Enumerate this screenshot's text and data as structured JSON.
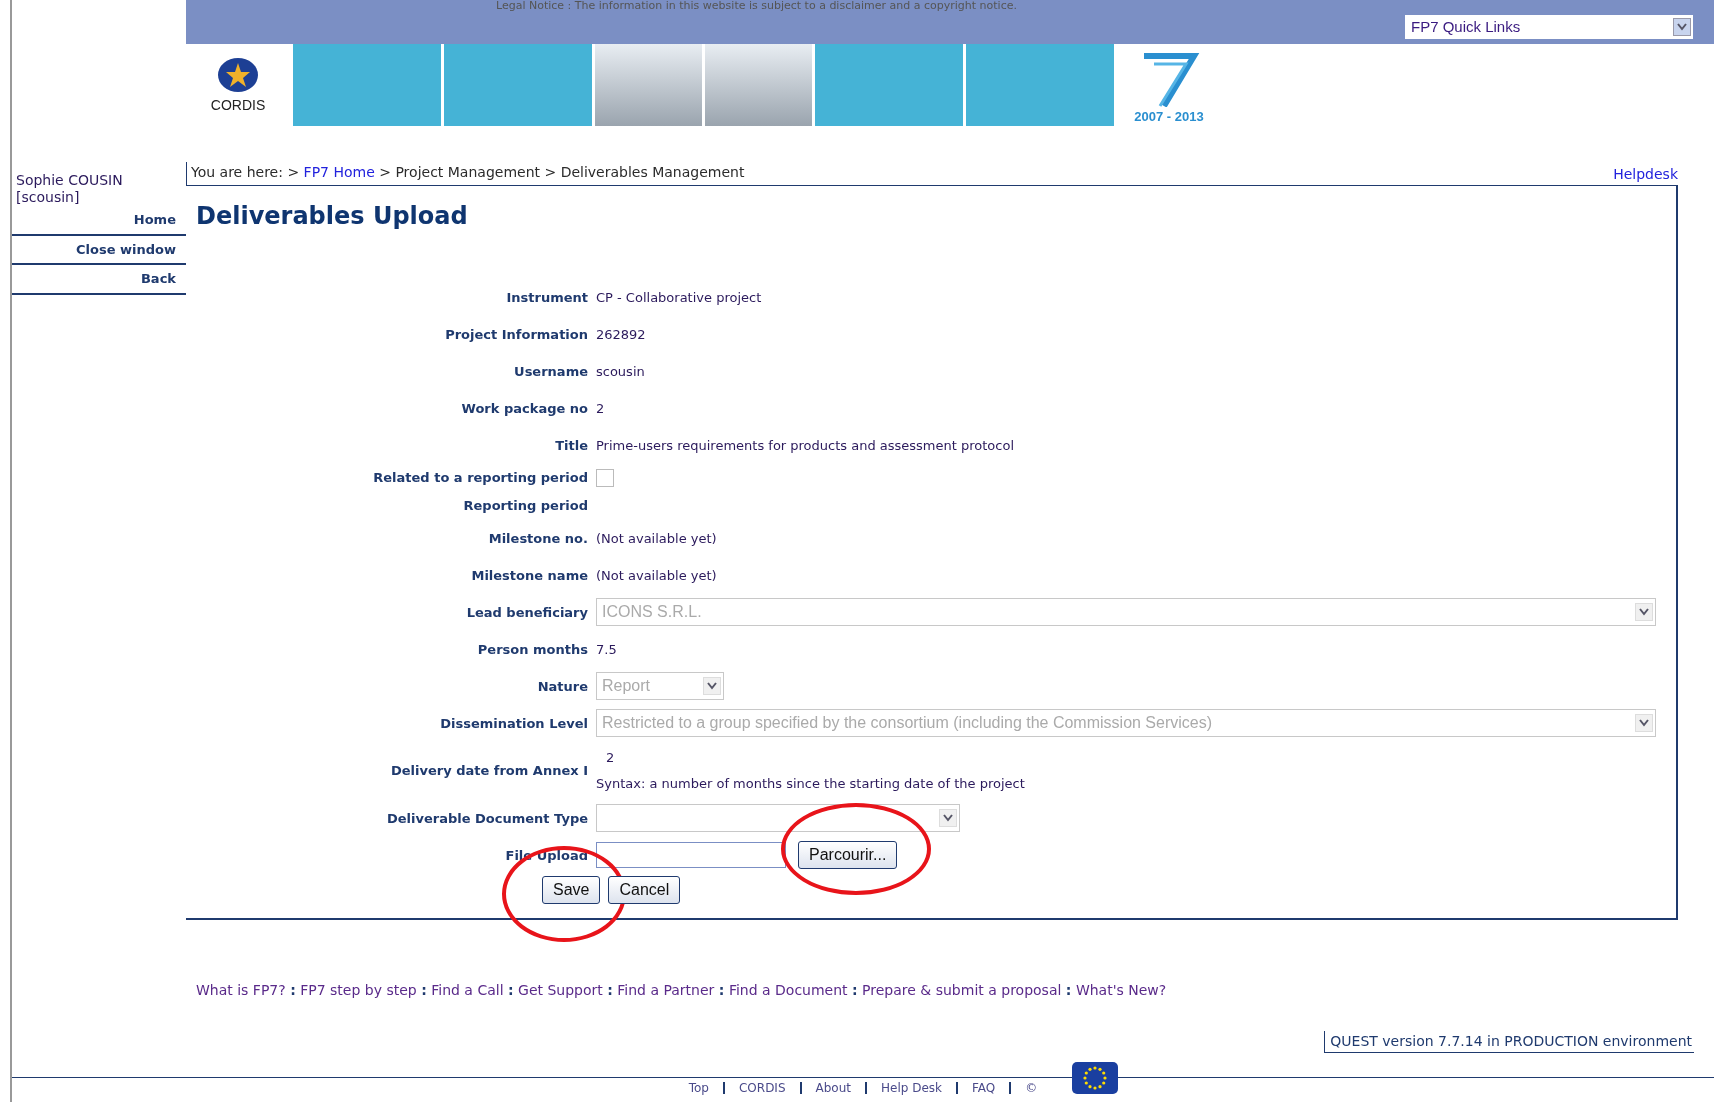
{
  "legal_notice": "Legal Notice : The information in this website is subject to a disclaimer and a copyright notice.",
  "quick_links": {
    "value": "FP7 Quick Links"
  },
  "logo": {
    "text": "CORDIS"
  },
  "fp7_logo": {
    "years": "2007 - 2013"
  },
  "banner_tiles": [
    {
      "kind": "plain"
    },
    {
      "kind": "plain"
    },
    {
      "kind": "photo"
    },
    {
      "kind": "photo"
    },
    {
      "kind": "plain"
    },
    {
      "kind": "plain"
    }
  ],
  "user": {
    "name": "Sophie COUSIN",
    "username": "[scousin]"
  },
  "sidebar": {
    "items": [
      "Home",
      "Close window",
      "Back"
    ]
  },
  "breadcrumb": {
    "prefix": "You are here:",
    "separator": ">",
    "items": [
      {
        "label": "FP7 Home",
        "link": true
      },
      {
        "label": "Project Management",
        "link": false
      },
      {
        "label": "Deliverables Management",
        "link": false
      }
    ]
  },
  "helpdesk": "Helpdesk",
  "page_title": "Deliverables Upload",
  "fields": [
    {
      "kind": "text",
      "label": "Instrument",
      "value": "CP - Collaborative project"
    },
    {
      "kind": "text",
      "label": "Project Information",
      "value": "262892"
    },
    {
      "kind": "text",
      "label": "Username",
      "value": "scousin"
    },
    {
      "kind": "text",
      "label": "Work package no",
      "value": "2"
    },
    {
      "kind": "text",
      "label": "Title",
      "value": "Prime-users requirements for products and assessment protocol"
    },
    {
      "kind": "checkbox",
      "label": "Related to a reporting period",
      "checked": false
    },
    {
      "kind": "empty",
      "label": "Reporting period"
    },
    {
      "kind": "text",
      "label": "Milestone no.",
      "value": "(Not available yet)"
    },
    {
      "kind": "text",
      "label": "Milestone name",
      "value": "(Not available yet)"
    },
    {
      "kind": "select_wide",
      "label": "Lead beneficiary",
      "value": "ICONS S.R.L.",
      "disabled": true
    },
    {
      "kind": "text",
      "label": "Person months",
      "value": "7.5"
    },
    {
      "kind": "select_short",
      "label": "Nature",
      "value": "Report",
      "disabled": true
    },
    {
      "kind": "select_wide",
      "label": "Dissemination Level",
      "value": "Restricted to a group specified by the consortium (including the Commission Services)",
      "disabled": true
    },
    {
      "kind": "hint",
      "label": "Delivery date from Annex I",
      "value": "2",
      "hint": "Syntax: a number of months since the starting date of the project"
    },
    {
      "kind": "select_medium",
      "label": "Deliverable Document Type",
      "disabled": false
    },
    {
      "kind": "file",
      "label": "File Upload",
      "button": "Parcourir...",
      "circled": true
    }
  ],
  "buttons": [
    {
      "label": "Save",
      "circled": true
    },
    {
      "label": "Cancel",
      "circled": false
    }
  ],
  "footer_links": {
    "separator": ":",
    "items": [
      "What is FP7?",
      "FP7 step by step",
      "Find a Call",
      "Get Support",
      "Find a Partner",
      "Find a Document",
      "Prepare & submit a proposal",
      "What's New?"
    ]
  },
  "version": "QUEST version 7.7.14 in PRODUCTION environment",
  "bottom_links": [
    "Top",
    "CORDIS",
    "About",
    "Help Desk",
    "FAQ",
    "©"
  ]
}
